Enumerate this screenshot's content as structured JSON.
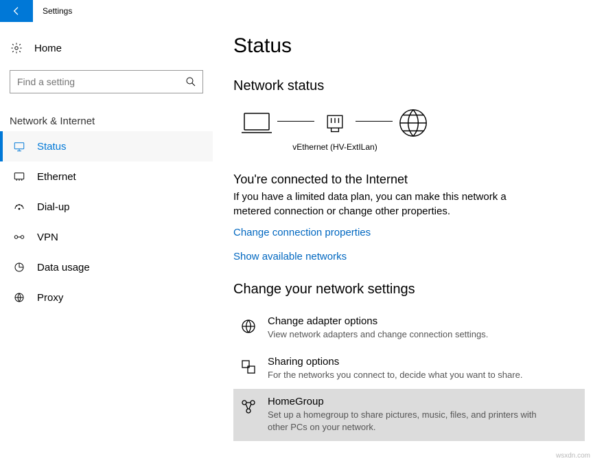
{
  "titlebar": {
    "title": "Settings"
  },
  "sidebar": {
    "home": "Home",
    "search_placeholder": "Find a setting",
    "section": "Network & Internet",
    "items": [
      {
        "label": "Status"
      },
      {
        "label": "Ethernet"
      },
      {
        "label": "Dial-up"
      },
      {
        "label": "VPN"
      },
      {
        "label": "Data usage"
      },
      {
        "label": "Proxy"
      }
    ]
  },
  "main": {
    "heading": "Status",
    "net_status_heading": "Network status",
    "adapter_label": "vEthernet (HV-ExtILan)",
    "connected_heading": "You're connected to the Internet",
    "connected_desc": "If you have a limited data plan, you can make this network a metered connection or change other properties.",
    "link_change_props": "Change connection properties",
    "link_show_networks": "Show available networks",
    "change_settings_heading": "Change your network settings",
    "options": [
      {
        "title": "Change adapter options",
        "sub": "View network adapters and change connection settings."
      },
      {
        "title": "Sharing options",
        "sub": "For the networks you connect to, decide what you want to share."
      },
      {
        "title": "HomeGroup",
        "sub": "Set up a homegroup to share pictures, music, files, and printers with other PCs on your network."
      }
    ]
  },
  "watermark": "wsxdn.com"
}
